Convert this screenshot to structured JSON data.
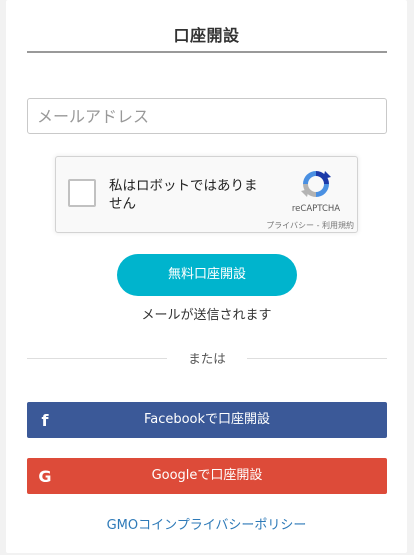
{
  "header": {
    "title": "口座開設"
  },
  "form": {
    "email_placeholder": "メールアドレス"
  },
  "recaptcha": {
    "label": "私はロボットではありません",
    "brand": "reCAPTCHA",
    "links": "プライバシー - 利用規約",
    "icon": "recaptcha-logo-icon"
  },
  "actions": {
    "open_account_label": "無料口座開設",
    "sent_note": "メールが送信されます",
    "or_label": "または"
  },
  "social": {
    "facebook": {
      "label": "Facebookで口座開設",
      "icon_glyph": "f",
      "icon": "facebook-icon",
      "color": "#3b5998"
    },
    "google": {
      "label": "Googleで口座開設",
      "icon_glyph": "G",
      "icon": "google-icon",
      "color": "#dd4b39"
    }
  },
  "footer": {
    "policy_link": "GMOコインプライバシーポリシー"
  },
  "colors": {
    "accent": "#00b4cd",
    "link": "#2e7ab8"
  }
}
